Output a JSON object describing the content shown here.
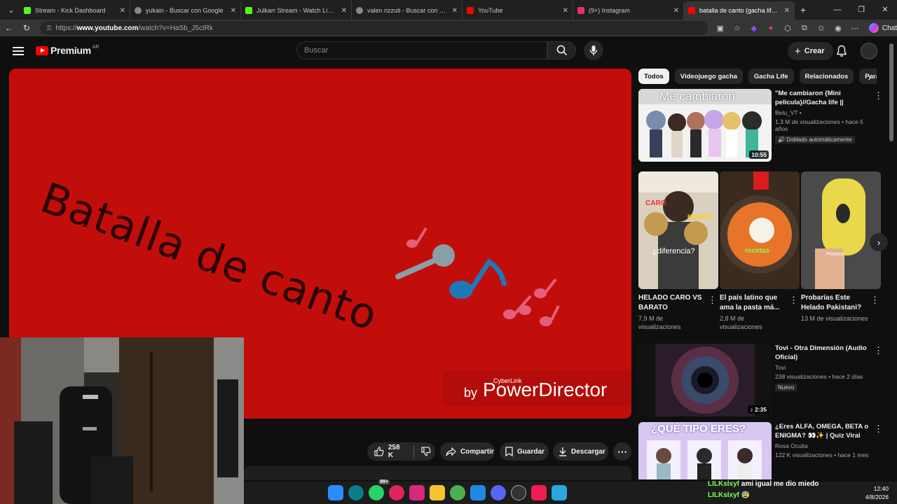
{
  "browser": {
    "tabs": [
      {
        "title": "Stream - Kick Dashboard",
        "favicon_color": "#53fc18"
      },
      {
        "title": "yukain - Buscar con Google",
        "favicon_color": "#888888"
      },
      {
        "title": "Julkarr Stream - Watch Live on Ki",
        "favicon_color": "#53fc18"
      },
      {
        "title": "valen rizzuti - Buscar con Google",
        "favicon_color": "#888888"
      },
      {
        "title": "YouTube",
        "favicon_color": "#ff0000"
      },
      {
        "title": "(9+) Instagram",
        "favicon_color": "#e1306c"
      },
      {
        "title": "batalla de canto (gacha life) - You",
        "favicon_color": "#ff0000"
      }
    ],
    "tab_close": "✕",
    "new_tab": "+",
    "url_prefix": "https://",
    "url_host": "www.youtube.com",
    "url_path": "/watch?v=HaSb_J5ctRk",
    "chat_label": "Chat"
  },
  "masthead": {
    "logo_word": "Premium",
    "country_code": "AR",
    "search_placeholder": "Buscar",
    "create_label": "Crear"
  },
  "player": {
    "title_text": "Batalla de canto",
    "watermark_by": "by",
    "watermark_brand": "CyberLink",
    "watermark_product": "PowerDirector",
    "background": "#c20e0b"
  },
  "actions": {
    "likes": "258 K",
    "share": "Compartir",
    "save": "Guardar",
    "download": "Descargar"
  },
  "chips": [
    "Todos",
    "Videojuego gacha",
    "Gacha Life",
    "Relacionados",
    "Para ti"
  ],
  "recommendations": [
    {
      "title": "\"Me cambiaron {Mini pelicula}//Gacha life ||•Sofi_Be...",
      "channel": "Belu_VT •",
      "views": "1,3 M de visualizaciones • hace 5 años",
      "badge": "Doblado automáticamente",
      "duration": "10:55",
      "thumb_caption": "Me cambiaron"
    },
    {
      "title": "Tovi - Otra Dimensión (Audio Oficial)",
      "channel": "Tovi",
      "views": "238 visualizaciones • hace 2 días",
      "badge": "Nuevo",
      "duration": "2:35"
    },
    {
      "title": "¿Eres ALFA, OMEGA, BETA o ENIGMA? 👀✨ | Quiz Viral de...",
      "channel": "Rosa Oculta",
      "views": "122 K visualizaciones • hace 1 mes",
      "thumb_caption": "¿QUÉ TIPO ERES?"
    }
  ],
  "shorts": [
    {
      "title": "HELADO CARO VS BARATO",
      "views": "7,9 M de visualizaciones",
      "caption_a": "CARO",
      "caption_b": "BARATO",
      "caption_c": "¿diferencia?"
    },
    {
      "title": "El país latino que ama la pasta má...",
      "views": "2,8 M de visualizaciones",
      "caption_a": "recetas"
    },
    {
      "title": "Probarías Este Helado Pakistani?",
      "views": "13 M de visualizaciones",
      "caption_a": "Primero"
    }
  ],
  "overlay_chat": [
    {
      "user": "LILKslxyf",
      "message": "ami igual me dio miedo"
    },
    {
      "user": "LILKslxyf",
      "message": "😰"
    }
  ],
  "clock": {
    "time": "12:40",
    "date": "4/8/2026"
  },
  "taskbar_badge": "99+"
}
